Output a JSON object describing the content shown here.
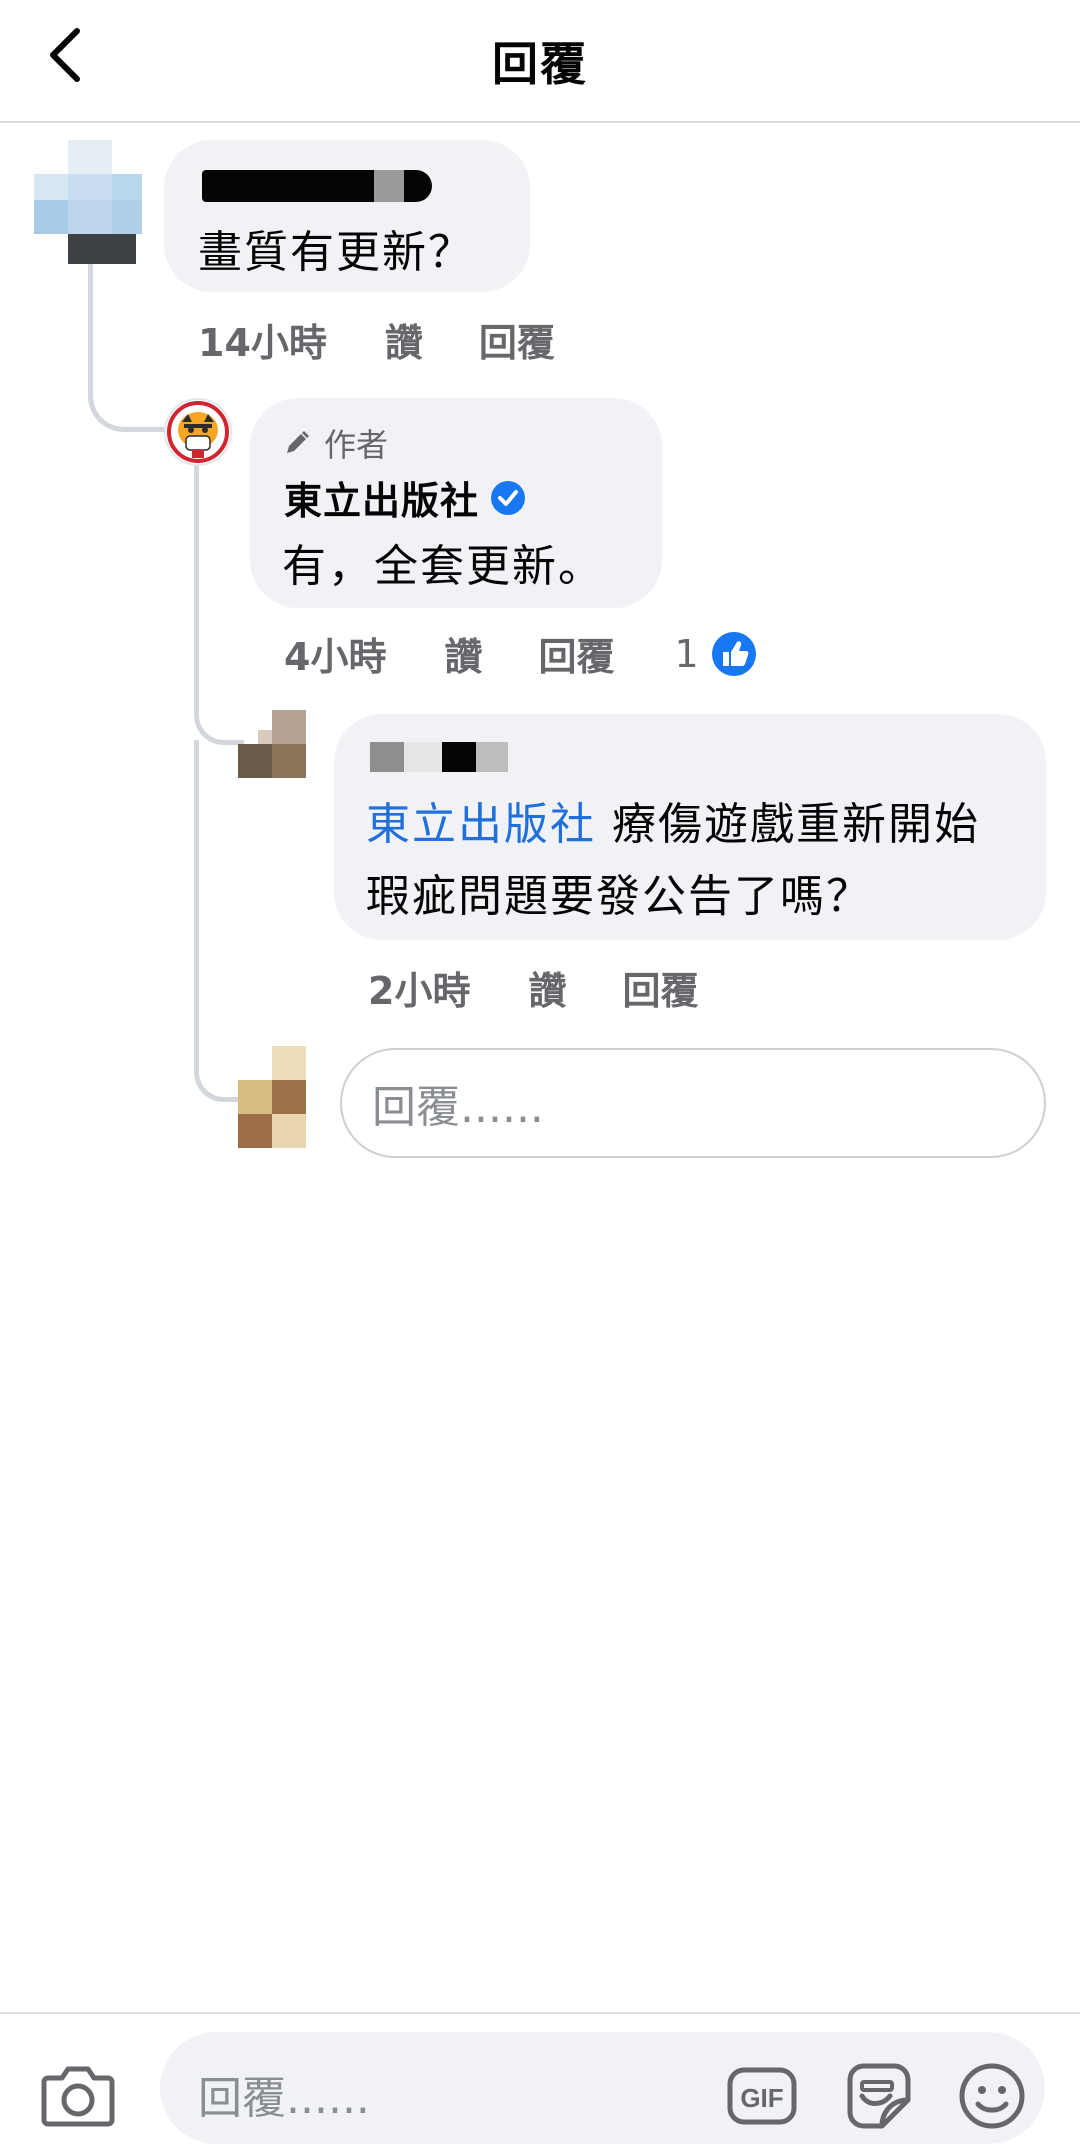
{
  "header": {
    "title": "回覆",
    "back_icon": "chevron-left-icon"
  },
  "comments": [
    {
      "text": "畫質有更新？",
      "time": "14小時",
      "like_label": "讚",
      "reply_label": "回覆"
    },
    {
      "badge_label": "作者",
      "badge_icon": "pencil-icon",
      "author": "東立出版社",
      "verified_icon": "verified-badge-icon",
      "text": "有，全套更新。",
      "time": "4小時",
      "like_label": "讚",
      "reply_label": "回覆",
      "reaction_count": "1",
      "reaction_icon": "like-reaction-icon"
    },
    {
      "mention": "東立出版社",
      "text_line1": " 療傷遊戲重新開始",
      "text_line2": "瑕疵問題要發公告了嗎？",
      "time": "2小時",
      "like_label": "讚",
      "reply_label": "回覆"
    }
  ],
  "reply_box": {
    "placeholder": "回覆......"
  },
  "composer": {
    "placeholder": "回覆......",
    "icons": [
      "camera-icon",
      "gif-icon",
      "sticker-icon",
      "emoji-icon"
    ]
  },
  "colors": {
    "accent": "#216fdb",
    "bubble": "#f0f2f5",
    "meta_text": "#65676b",
    "like_blue": "#1877f2"
  }
}
